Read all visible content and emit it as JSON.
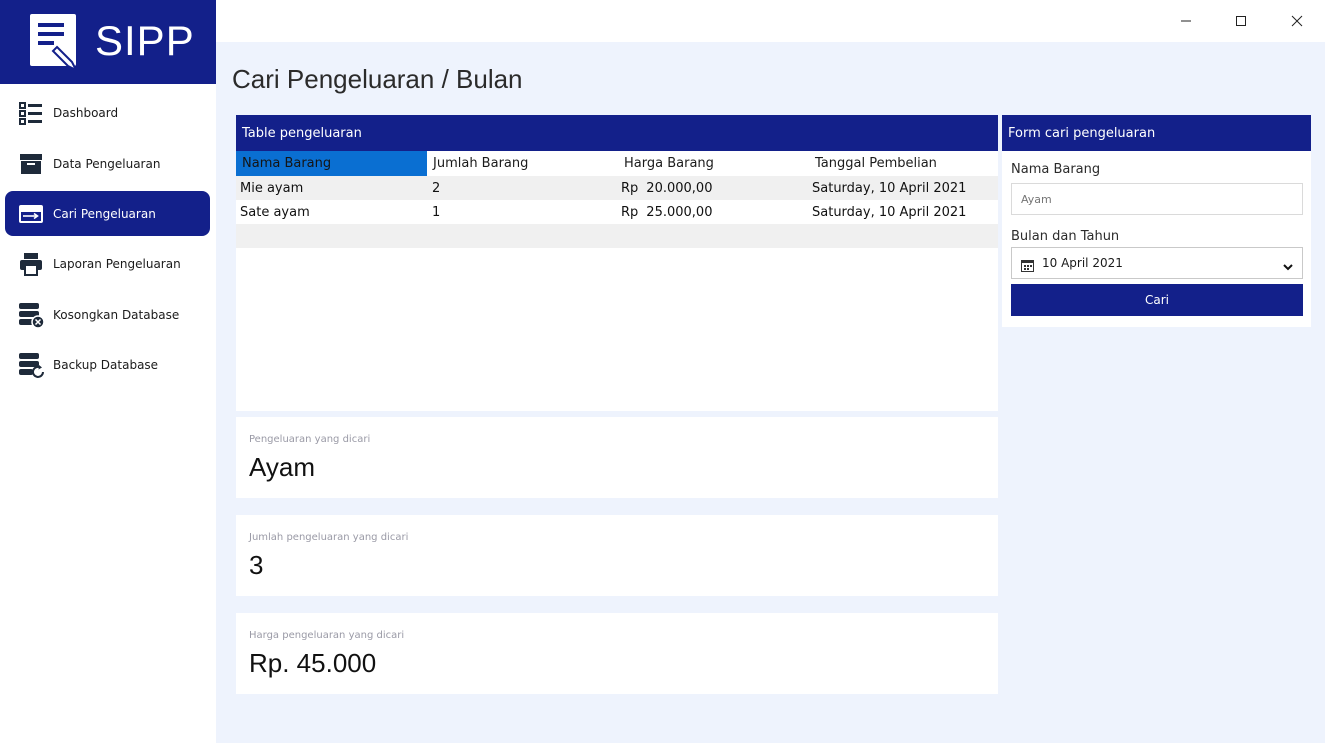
{
  "app": {
    "name": "SIPP",
    "colors": {
      "primary": "#13208a",
      "background": "#eef3fd",
      "selection": "#0a6fd2"
    }
  },
  "window_controls": [
    "minimize",
    "maximize",
    "close"
  ],
  "sidebar": {
    "items": [
      {
        "label": "Dashboard",
        "icon": "list-icon",
        "active": false
      },
      {
        "label": "Data Pengeluaran",
        "icon": "archive-box-icon",
        "active": false
      },
      {
        "label": "Cari Pengeluaran",
        "icon": "arrow-right-box-icon",
        "active": true
      },
      {
        "label": "Laporan Pengeluaran",
        "icon": "printer-icon",
        "active": false
      },
      {
        "label": "Kosongkan Database",
        "icon": "database-clear-icon",
        "active": false
      },
      {
        "label": "Backup Database",
        "icon": "database-backup-icon",
        "active": false
      }
    ]
  },
  "page": {
    "title": "Cari Pengeluaran / Bulan"
  },
  "table": {
    "title": "Table pengeluaran",
    "columns": [
      "Nama Barang",
      "Jumlah Barang",
      "Harga Barang",
      "Tanggal Pembelian"
    ],
    "rows": [
      {
        "nama": "Mie ayam",
        "jumlah": "2",
        "currency": "Rp",
        "harga": "20.000,00",
        "tanggal": "Saturday, 10 April 2021"
      },
      {
        "nama": "Sate ayam",
        "jumlah": "1",
        "currency": "Rp",
        "harga": "25.000,00",
        "tanggal": "Saturday, 10 April 2021"
      }
    ]
  },
  "summary": {
    "search_term": {
      "label": "Pengeluaran yang dicari",
      "value": "Ayam"
    },
    "count": {
      "label": "Jumlah pengeluaran yang dicari",
      "value": "3"
    },
    "total": {
      "label": "Harga pengeluaran yang dicari",
      "value": "Rp. 45.000"
    }
  },
  "form": {
    "title": "Form cari pengeluaran",
    "nama_label": "Nama Barang",
    "nama_placeholder": "Ayam",
    "date_label": "Bulan dan Tahun",
    "date_value": "10 April 2021",
    "submit_label": "Cari"
  }
}
